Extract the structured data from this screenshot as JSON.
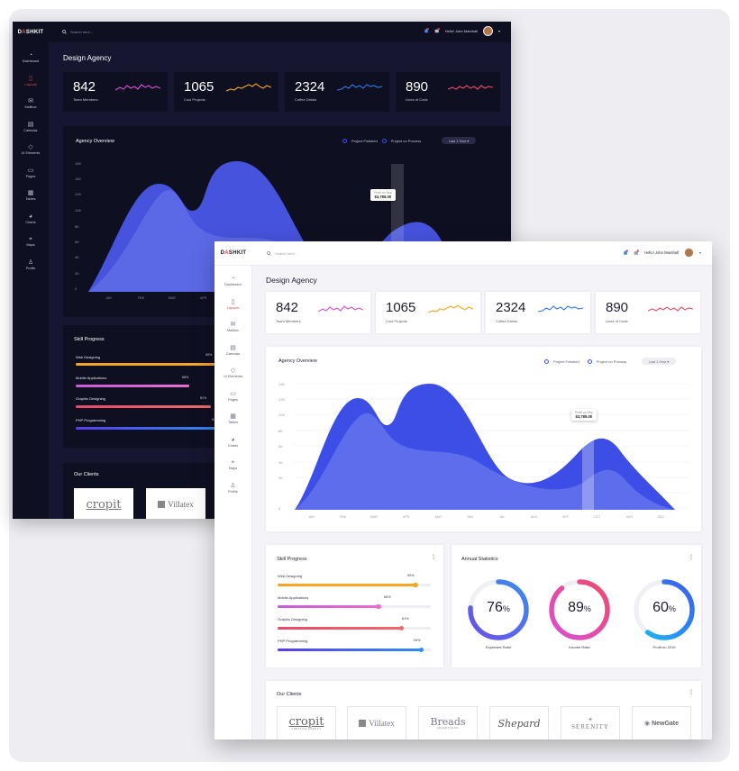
{
  "colors": {
    "accent": "#3d4ee6",
    "danger": "#e04848",
    "orange": "#f5a623",
    "pink": "#d94fd4",
    "red": "#ef4a6a",
    "blue": "#3b5bf0"
  },
  "brand": {
    "pre": "D",
    "mark": "A",
    "post": "SHKIT"
  },
  "search": {
    "placeholder": "Search here..."
  },
  "user": {
    "greeting": "Hello! John Marshall"
  },
  "sidebar": [
    {
      "label": "Dashboard",
      "icon": "gauge-icon"
    },
    {
      "label": "Layouts",
      "icon": "layouts-icon",
      "active": true
    },
    {
      "label": "Mailbox",
      "icon": "mail-icon"
    },
    {
      "label": "Calendar",
      "icon": "calendar-icon"
    },
    {
      "label": "UI Elements",
      "icon": "diamond-icon"
    },
    {
      "label": "Pages",
      "icon": "pages-icon"
    },
    {
      "label": "Tables",
      "icon": "table-icon"
    },
    {
      "label": "Charts",
      "icon": "chart-icon"
    },
    {
      "label": "Maps",
      "icon": "map-pin-icon"
    },
    {
      "label": "Profile",
      "icon": "user-icon"
    }
  ],
  "page_title": "Design Agency",
  "stats": [
    {
      "value": "842",
      "label": "Team Members",
      "color": "#d94fd4"
    },
    {
      "value": "1065",
      "label": "Cool Projects",
      "color": "#f5a623"
    },
    {
      "value": "2324",
      "label": "Coffee Drinks",
      "color": "#2f7be8"
    },
    {
      "value": "890",
      "label": "Lines of Code",
      "color": "#ef4a6a"
    }
  ],
  "overview": {
    "title": "Agency Overview",
    "legend": [
      "Project Finished",
      "Project on Process"
    ],
    "range": "Last 1 Year",
    "tooltip_label": "Profit on Sep",
    "tooltip_value": "$3,789.00",
    "y_ticks": [
      "14K",
      "12K",
      "10K",
      "8K",
      "6K",
      "4K",
      "2K",
      "0"
    ],
    "dark_y_ticks": [
      "16K",
      "14K",
      "12K",
      "10K",
      "8K",
      "6K",
      "4K",
      "2K",
      "0"
    ],
    "x_ticks": [
      "JAN",
      "FEB",
      "MAR",
      "APR",
      "MAY",
      "JUN",
      "JUL",
      "AUG",
      "SEP",
      "OCT",
      "NOV",
      "DEC"
    ]
  },
  "skills": {
    "title": "Skill Progress",
    "items": [
      {
        "name": "Web Designing",
        "value": "90%",
        "fraction": 0.9,
        "from": "#f5a623",
        "to": "#f5a623"
      },
      {
        "name": "Mobile Applications",
        "value": "66%",
        "fraction": 0.66,
        "from": "#c85bd8",
        "to": "#e86dd0"
      },
      {
        "name": "Graphic Designing",
        "value": "81%",
        "fraction": 0.81,
        "from": "#e84a6a",
        "to": "#f06a6a"
      },
      {
        "name": "PHP Programming",
        "value": "94%",
        "fraction": 0.94,
        "from": "#5a3de8",
        "to": "#2f8cf0"
      }
    ]
  },
  "annual": {
    "title": "Annual Statistics",
    "rings": [
      {
        "value": "76",
        "unit": "%",
        "fraction": 0.76,
        "label": "Expenses Ratio",
        "from": "#6b4fe8",
        "to": "#3b8cf0"
      },
      {
        "value": "89",
        "unit": "%",
        "fraction": 0.89,
        "label": "Income Ratio",
        "from": "#d94fd4",
        "to": "#ef4a6a"
      },
      {
        "value": "60",
        "unit": "%",
        "fraction": 0.6,
        "label": "Profit on 2019",
        "from": "#1fb8f0",
        "to": "#3b5bf0"
      }
    ]
  },
  "clients": {
    "title": "Our Clients",
    "logos": [
      "cropit",
      "Villatex",
      "Breads",
      "Shepard",
      "SERENITY",
      "NewGate"
    ],
    "logo_subs": [
      "CREATIVE AGENCY",
      "",
      "ADVERTISING",
      "",
      "",
      ""
    ]
  }
}
